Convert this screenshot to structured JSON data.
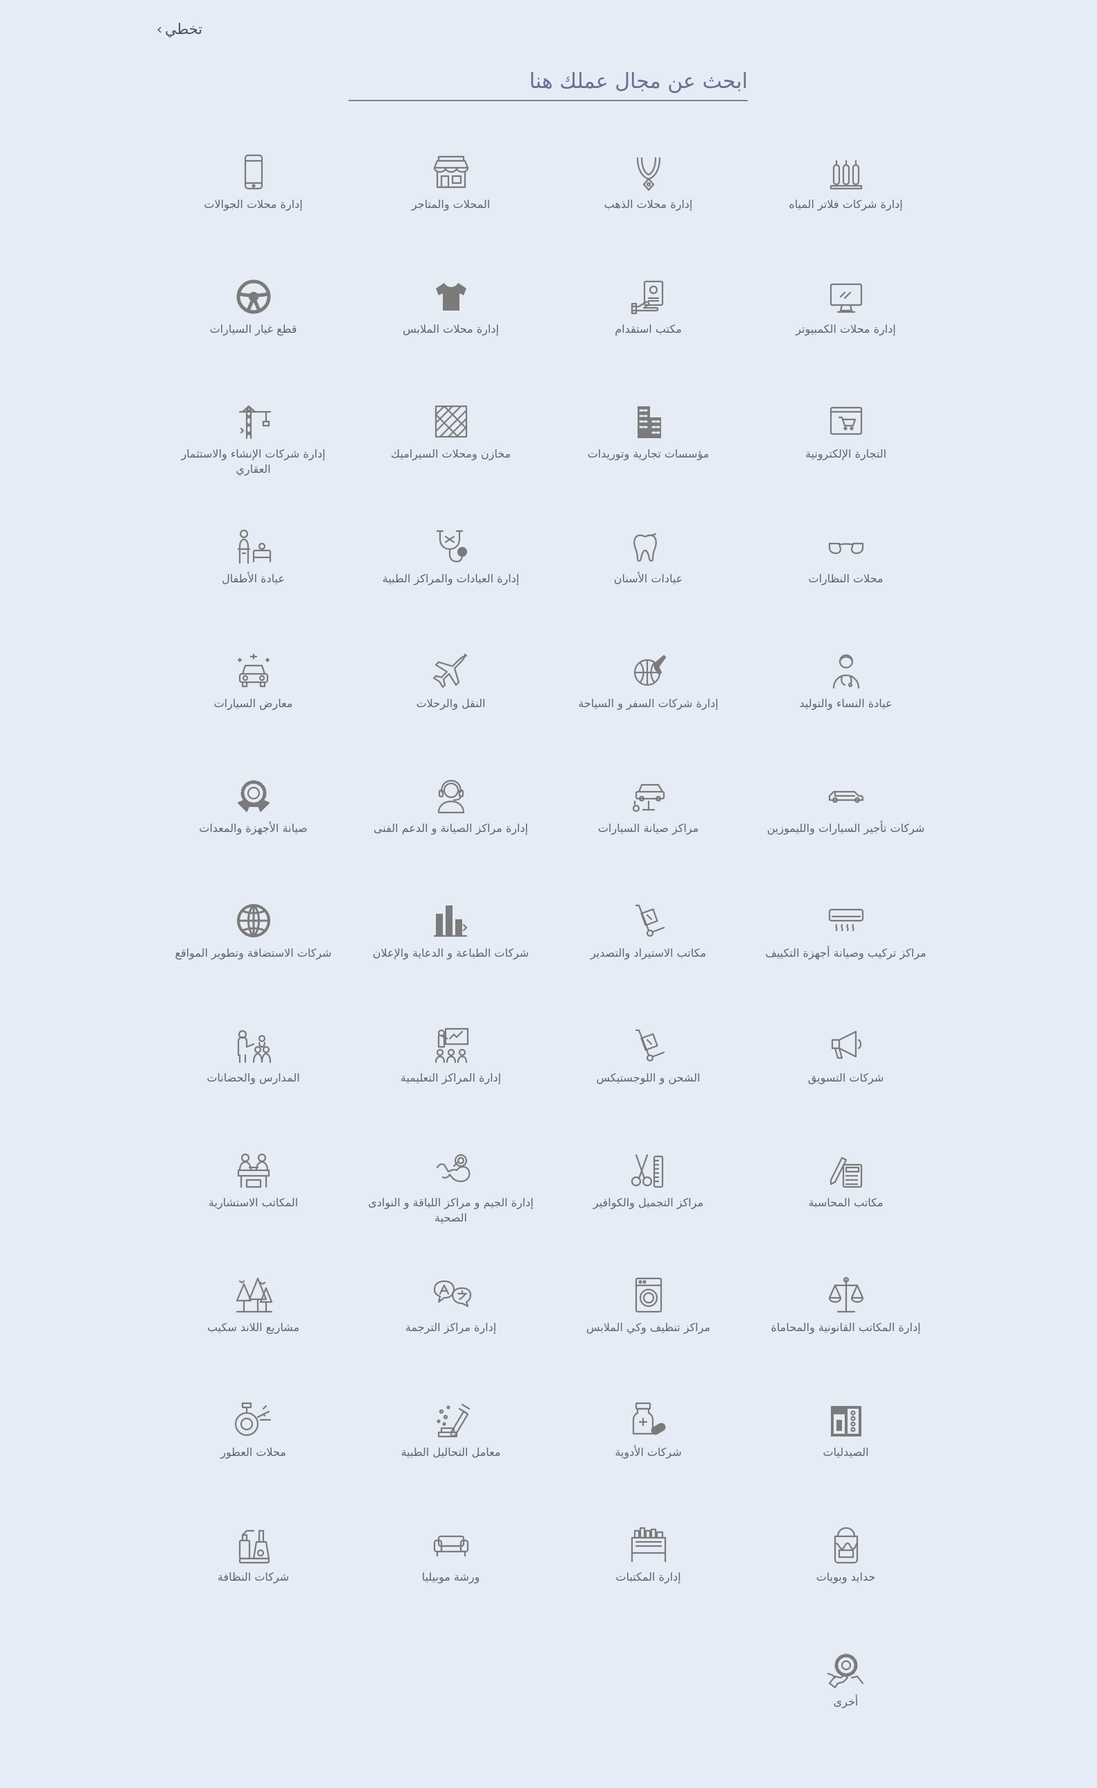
{
  "header": {
    "skip_label": "تخطي",
    "skip_icon": "chevron-right-icon"
  },
  "search": {
    "placeholder": "ابحث عن مجال عملك هنا",
    "value": ""
  },
  "categories": [
    {
      "label": "إدارة شركات فلاتر المياه",
      "icon": "water-filter-icon"
    },
    {
      "label": "إدارة محلات الذهب",
      "icon": "gold-necklace-icon"
    },
    {
      "label": "المحلات والمتاجر",
      "icon": "storefront-icon"
    },
    {
      "label": "إدارة محلات الجوالات",
      "icon": "mobile-phone-icon"
    },
    {
      "label": "إدارة محلات الكمبيوتر",
      "icon": "computer-monitor-icon"
    },
    {
      "label": "مكتب استقدام",
      "icon": "recruitment-card-icon"
    },
    {
      "label": "إدارة محلات الملابس",
      "icon": "t-shirt-icon"
    },
    {
      "label": "قطع غيار السيارات",
      "icon": "steering-wheel-icon"
    },
    {
      "label": "التجارة الإلكترونية",
      "icon": "ecommerce-cart-icon"
    },
    {
      "label": "مؤسسات تجارية وتوريدات",
      "icon": "buildings-icon"
    },
    {
      "label": "مخازن ومحلات السيراميك",
      "icon": "ceramic-tiles-icon"
    },
    {
      "label": "إدارة شركات الإنشاء والاستثمار العقاري",
      "icon": "construction-crane-icon"
    },
    {
      "label": "محلات النظارات",
      "icon": "eyeglasses-icon"
    },
    {
      "label": "عيادات الأسنان",
      "icon": "tooth-icon"
    },
    {
      "label": "إدارة العيادات والمراكز الطبية",
      "icon": "stethoscope-icon"
    },
    {
      "label": "عيادة الأطفال",
      "icon": "pediatric-icon"
    },
    {
      "label": "عيادة النساء والتوليد",
      "icon": "doctor-icon"
    },
    {
      "label": "إدارة شركات السفر و السياحة",
      "icon": "globe-plane-icon"
    },
    {
      "label": "النقل والرحلات",
      "icon": "airplane-icon"
    },
    {
      "label": "معارض السيارات",
      "icon": "car-showroom-icon"
    },
    {
      "label": "شركات تأجير السيارات والليموزين",
      "icon": "limousine-icon"
    },
    {
      "label": "مراكز صيانة السيارات",
      "icon": "car-lift-icon"
    },
    {
      "label": "إدارة مراكز الصيانة و الدعم الفنى",
      "icon": "support-headset-icon"
    },
    {
      "label": "صيانة الأجهزة والمعدات",
      "icon": "gear-wrench-icon"
    },
    {
      "label": "مراكز تركيب وصيانة أجهزة التكييف",
      "icon": "air-conditioner-icon"
    },
    {
      "label": "مكاتب الاستيراد والتصدير",
      "icon": "hand-truck-icon"
    },
    {
      "label": "شركات الطباعة و الدعاية والإعلان",
      "icon": "bar-chart-icon"
    },
    {
      "label": "شركات الاستضافة وتطوير المواقع",
      "icon": "globe-icon"
    },
    {
      "label": "شركات التسويق",
      "icon": "megaphone-icon"
    },
    {
      "label": "الشحن و اللوجستيكس",
      "icon": "hand-truck-icon"
    },
    {
      "label": "إدارة المراكز التعليمية",
      "icon": "presentation-class-icon"
    },
    {
      "label": "المدارس والحضانات",
      "icon": "teacher-children-icon"
    },
    {
      "label": "مكاتب المحاسبة",
      "icon": "calculator-icon"
    },
    {
      "label": "مراكز التجميل والكوافير",
      "icon": "scissors-comb-icon"
    },
    {
      "label": "إدارة الجيم و مراكز اللياقة و النوادى الصحية",
      "icon": "muscle-arm-icon"
    },
    {
      "label": "المكاتب الاستشارية",
      "icon": "meeting-table-icon"
    },
    {
      "label": "إدارة المكاتب القانونية والمحاماة",
      "icon": "scales-icon"
    },
    {
      "label": "مراكز تنظيف وكي الملابس",
      "icon": "washing-machine-icon"
    },
    {
      "label": "إدارة مراكز الترجمة",
      "icon": "translation-icon"
    },
    {
      "label": "مشاريع اللاند سكيب",
      "icon": "trees-icon"
    },
    {
      "label": "الصيدليات",
      "icon": "pharmacy-shelf-icon"
    },
    {
      "label": "شركات الأدوية",
      "icon": "medicine-bottle-icon"
    },
    {
      "label": "معامل التحاليل الطبية",
      "icon": "lab-dropper-icon"
    },
    {
      "label": "محلات العطور",
      "icon": "perfume-bottle-icon"
    },
    {
      "label": "حدايد وبويات",
      "icon": "paint-bucket-icon"
    },
    {
      "label": "إدارة المكتبات",
      "icon": "books-shelf-icon"
    },
    {
      "label": "ورشة موبيليا",
      "icon": "sofa-icon"
    },
    {
      "label": "شركات النظافة",
      "icon": "cleaning-supplies-icon"
    },
    {
      "label": "أخرى",
      "icon": "gear-hand-icon"
    }
  ]
}
